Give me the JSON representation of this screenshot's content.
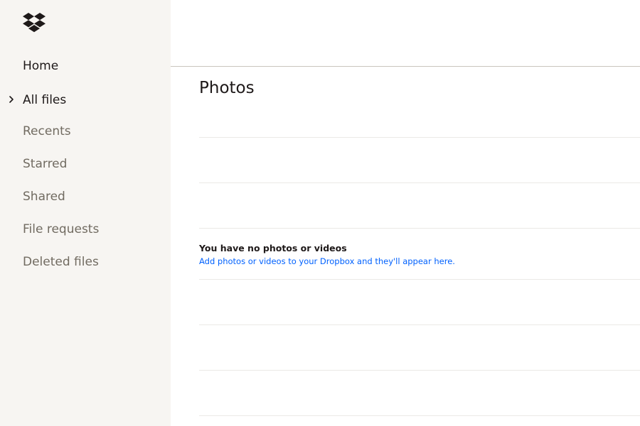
{
  "brand": {
    "logo_icon": "dropbox-logo-icon",
    "color": "#1e1919"
  },
  "sidebar": {
    "items": [
      {
        "label": "Home"
      },
      {
        "label": "All files",
        "icon": "chevron-right-icon"
      },
      {
        "label": "Recents"
      },
      {
        "label": "Starred"
      },
      {
        "label": "Shared"
      },
      {
        "label": "File requests"
      },
      {
        "label": "Deleted files"
      }
    ]
  },
  "main": {
    "title": "Photos",
    "empty_state": {
      "title": "You have no photos or videos",
      "message": "Add photos or videos to your Dropbox and they'll appear here."
    }
  },
  "colors": {
    "sidebar_bg": "#f7f5f2",
    "link": "#0061fe",
    "text_primary": "#1e1919",
    "text_secondary": "#716b61"
  }
}
